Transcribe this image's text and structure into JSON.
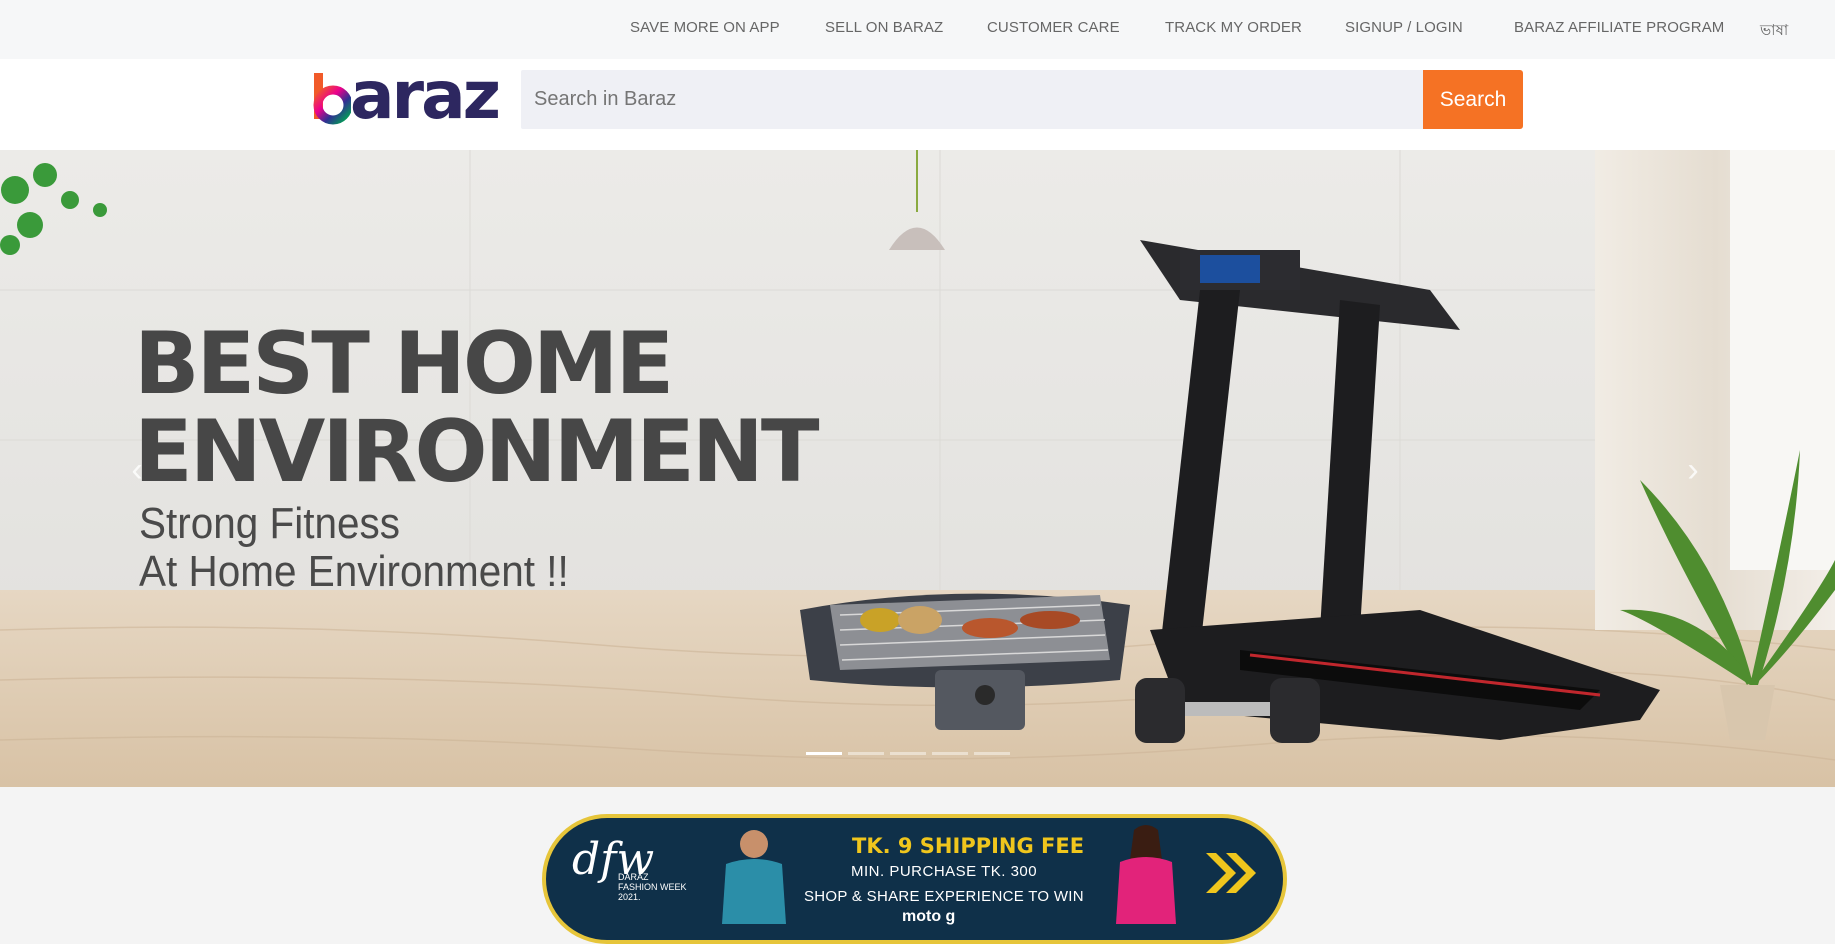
{
  "topbar": {
    "links": [
      {
        "label": "SAVE MORE ON APP"
      },
      {
        "label": "SELL ON BARAZ"
      },
      {
        "label": "CUSTOMER CARE"
      },
      {
        "label": "TRACK MY ORDER"
      },
      {
        "label": "SIGNUP / LOGIN"
      },
      {
        "label": "BARAZ AFFILIATE PROGRAM"
      },
      {
        "label": "ভাষা"
      }
    ]
  },
  "header": {
    "logo_text": "baraz",
    "search_placeholder": "Search in Baraz",
    "search_button": "Search"
  },
  "hero": {
    "title_line1": "BEST HOME",
    "title_line2": "ENVIRONMENT",
    "subtitle_line1": "Strong Fitness",
    "subtitle_line2": "At Home Environment !!",
    "prev_icon": "chevron-left-icon",
    "next_icon": "chevron-right-icon",
    "slide_count": 5,
    "active_slide": 1
  },
  "promo": {
    "brand_mark": "dfw",
    "brand_sub1": "DARAZ",
    "brand_sub2": "FASHION WEEK",
    "brand_sub3": "2021.",
    "headline": "TK. 9 SHIPPING FEE",
    "line2": "MIN. PURCHASE TK. 300",
    "line3": "SHOP & SHARE EXPERIENCE TO WIN",
    "line4": "moto g",
    "arrow_icon": "double-chevron-right-icon"
  },
  "colors": {
    "accent": "#f57224",
    "logo": "#2d2760",
    "promo_bg": "#0f3049",
    "promo_yellow": "#f0c61d"
  }
}
